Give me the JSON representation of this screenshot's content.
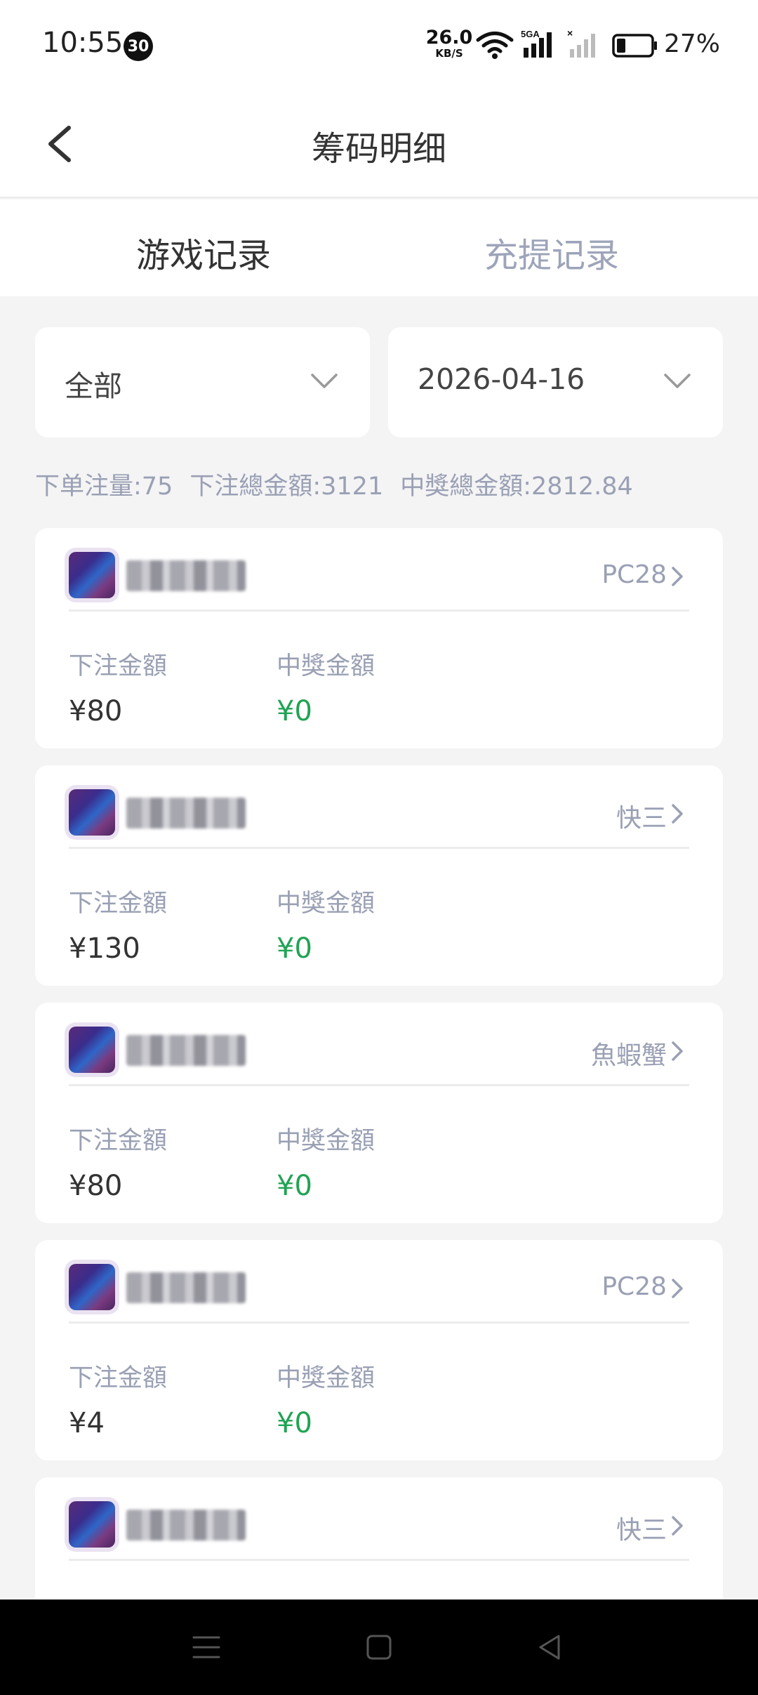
{
  "status_bar": {
    "time": "10:55",
    "badge": "30",
    "net_speed": "26.0",
    "net_unit": "KB/S",
    "signal_label": "5GA",
    "battery": "27%"
  },
  "header": {
    "title": "筹码明细"
  },
  "tabs": [
    {
      "label": "游戏记录",
      "active": true
    },
    {
      "label": "充提记录",
      "active": false
    }
  ],
  "filters": {
    "category": "全部",
    "date": "2026-04-16"
  },
  "summary": {
    "bet_count": "下单注量:75",
    "bet_total": "下注總金額:3121",
    "win_total": "中獎總金額:2812.84"
  },
  "card_labels": {
    "bet": "下注金額",
    "win": "中獎金額"
  },
  "records": [
    {
      "game": "PC28",
      "bet": "¥80",
      "win": "¥0"
    },
    {
      "game": "快三",
      "bet": "¥130",
      "win": "¥0"
    },
    {
      "game": "魚蝦蟹",
      "bet": "¥80",
      "win": "¥0"
    },
    {
      "game": "PC28",
      "bet": "¥4",
      "win": "¥0"
    },
    {
      "game": "快三"
    }
  ],
  "colors": {
    "win_green": "#21a354",
    "muted": "#9aa0b4",
    "background": "#f4f4f5"
  },
  "icons": {
    "back": "chevron-left-icon",
    "dropdown": "chevron-down-icon",
    "row_arrow": "chevron-right-icon"
  }
}
